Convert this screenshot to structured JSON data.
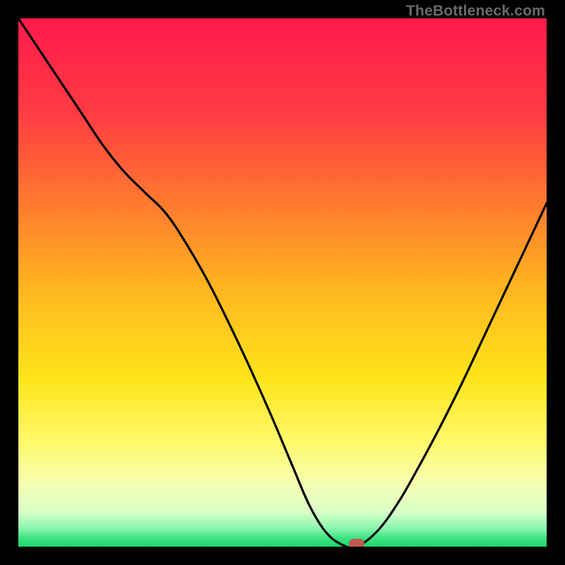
{
  "watermark": "TheBottleneck.com",
  "marker_color": "#c1584f",
  "curve_color": "#000000",
  "chart_data": {
    "type": "line",
    "title": "",
    "xlabel": "",
    "ylabel": "",
    "xlim": [
      0,
      100
    ],
    "ylim": [
      0,
      100
    ],
    "grid": false,
    "legend": false,
    "gradient_stops": [
      {
        "pos": 0.0,
        "color": "#ff1a4b"
      },
      {
        "pos": 0.18,
        "color": "#ff3b43"
      },
      {
        "pos": 0.35,
        "color": "#ff7a2f"
      },
      {
        "pos": 0.52,
        "color": "#ffb81f"
      },
      {
        "pos": 0.68,
        "color": "#ffe41a"
      },
      {
        "pos": 0.8,
        "color": "#fff86a"
      },
      {
        "pos": 0.88,
        "color": "#f6ffb0"
      },
      {
        "pos": 0.935,
        "color": "#d8ffc8"
      },
      {
        "pos": 0.965,
        "color": "#8cf5b0"
      },
      {
        "pos": 0.985,
        "color": "#38e27f"
      },
      {
        "pos": 1.0,
        "color": "#1fd868"
      }
    ],
    "series": [
      {
        "name": "bottleneck-curve",
        "x": [
          0.0,
          4.0,
          8.0,
          12.0,
          16.0,
          20.0,
          24.0,
          28.0,
          32.0,
          36.0,
          40.0,
          44.0,
          48.0,
          52.0,
          55.0,
          58.0,
          61.0,
          64.0,
          68.0,
          72.0,
          76.0,
          80.0,
          84.0,
          88.0,
          92.0,
          96.0,
          100.0
        ],
        "y": [
          100.0,
          94.0,
          88.0,
          82.0,
          76.0,
          71.0,
          67.0,
          63.0,
          57.0,
          50.0,
          42.0,
          33.5,
          24.5,
          15.0,
          8.0,
          3.0,
          0.5,
          0.0,
          3.0,
          8.5,
          15.5,
          23.0,
          31.0,
          39.5,
          48.0,
          56.5,
          65.0
        ]
      }
    ],
    "marker": {
      "x": 64.0,
      "y": 0.0
    }
  }
}
